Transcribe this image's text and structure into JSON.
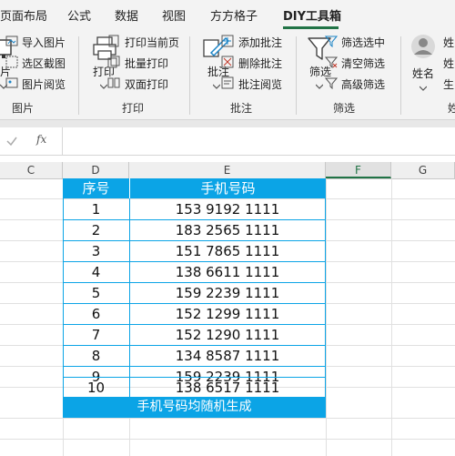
{
  "tabs": [
    "页面布局",
    "公式",
    "数据",
    "视图",
    "方方格子",
    "DIY工具箱"
  ],
  "ribbon": {
    "picture_group": {
      "items": [
        "导入图片",
        "选区截图",
        "图片阅览"
      ],
      "large_label": "片",
      "group_label": "图片"
    },
    "print_group": {
      "large_label": "打印",
      "items": [
        "打印当前页",
        "批量打印",
        "双面打印"
      ],
      "group_label": "打印"
    },
    "comment_group": {
      "large_label": "批注",
      "items": [
        "添加批注",
        "删除批注",
        "批注阅览"
      ],
      "group_label": "批注"
    },
    "filter_group": {
      "large_label": "筛选",
      "items": [
        "筛选选中",
        "清空筛选",
        "高级筛选"
      ],
      "group_label": "筛选"
    },
    "name_group": {
      "large_label": "姓名",
      "items": [
        "姓",
        "姓",
        "生"
      ],
      "group_label": "姓"
    }
  },
  "formula_bar": {
    "cancel_icon": "x-icon",
    "confirm_icon": "check-icon",
    "fx": "fx",
    "value": ""
  },
  "columns": [
    "C",
    "D",
    "E",
    "F",
    "G"
  ],
  "table": {
    "headers": [
      "序号",
      "手机号码"
    ],
    "rows": [
      [
        "1",
        "153 9192 1111"
      ],
      [
        "2",
        "183 2565 1111"
      ],
      [
        "3",
        "151 7865 1111"
      ],
      [
        "4",
        "138 6611 1111"
      ],
      [
        "5",
        "159 2239 1111"
      ],
      [
        "6",
        "152 1299 1111"
      ],
      [
        "7",
        "152 1290 1111"
      ],
      [
        "8",
        "134 8587 1111"
      ],
      [
        "9",
        "159 2239 1111"
      ],
      [
        "10",
        "138 6517 1111"
      ]
    ],
    "footer": "手机号码均随机生成"
  },
  "colors": {
    "accent": "#217346",
    "table_header": "#0ba4e6"
  }
}
